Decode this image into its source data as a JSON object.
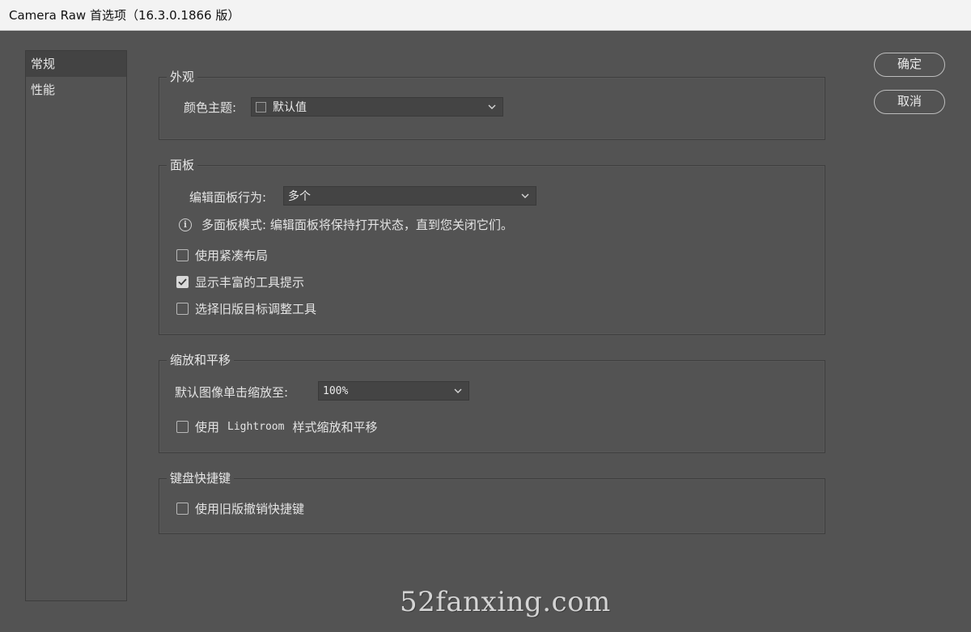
{
  "window": {
    "title": "Camera Raw 首选项（16.3.0.1866 版）"
  },
  "sidebar": {
    "items": [
      {
        "label": "常规",
        "selected": true
      },
      {
        "label": "性能",
        "selected": false
      }
    ]
  },
  "buttons": {
    "ok": "确定",
    "cancel": "取消"
  },
  "appearance": {
    "title": "外观",
    "theme_label": "颜色主题:",
    "theme_value": "默认值"
  },
  "panels": {
    "title": "面板",
    "behavior_label": "编辑面板行为:",
    "behavior_value": "多个",
    "info_text": "多面板模式: 编辑面板将保持打开状态，直到您关闭它们。",
    "options": [
      {
        "label": "使用紧凑布局",
        "checked": false
      },
      {
        "label": "显示丰富的工具提示",
        "checked": true
      },
      {
        "label": "选择旧版目标调整工具",
        "checked": false
      }
    ]
  },
  "zoom": {
    "title": "缩放和平移",
    "default_zoom_label": "默认图像单击缩放至:",
    "default_zoom_value": "100%",
    "lightroom_prefix": "使用",
    "lightroom_word": "Lightroom",
    "lightroom_suffix": "样式缩放和平移",
    "lightroom_checked": false
  },
  "shortcuts": {
    "title": "键盘快捷键",
    "legacy_undo_label": "使用旧版撤销快捷键",
    "legacy_undo_checked": false
  },
  "watermark": "52fanxing.com",
  "colors": {
    "background": "#535353",
    "titlebar": "#f3f3f3",
    "selected_item": "#434343",
    "dropdown": "#444444"
  }
}
